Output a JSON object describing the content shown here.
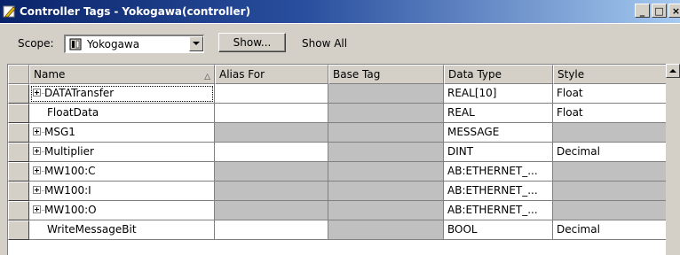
{
  "window": {
    "title": "Controller Tags",
    "title_sep": "-",
    "subtitle": "Yokogawa(controller)",
    "btn_minimize": "_",
    "btn_maximize": "□",
    "btn_close": "×"
  },
  "toolbar": {
    "scope_label": "Scope:",
    "scope_value": "Yokogawa",
    "show_button": "Show...",
    "show_filter": "Show All"
  },
  "grid": {
    "headers": {
      "name": "Name",
      "alias": "Alias For",
      "base": "Base Tag",
      "type": "Data Type",
      "style": "Style"
    },
    "rows": [
      {
        "name": "DATATransfer",
        "expandable": true,
        "alias": "",
        "base": "",
        "type": "REAL[10]",
        "style": "Float",
        "editable": true
      },
      {
        "name": "FloatData",
        "expandable": false,
        "alias": "",
        "base": "",
        "type": "REAL",
        "style": "Float",
        "editable": true
      },
      {
        "name": "MSG1",
        "expandable": true,
        "alias": "",
        "base": "",
        "type": "MESSAGE",
        "style": "",
        "editable": false
      },
      {
        "name": "Multiplier",
        "expandable": true,
        "alias": "",
        "base": "",
        "type": "DINT",
        "style": "Decimal",
        "editable": true
      },
      {
        "name": "MW100:C",
        "expandable": true,
        "alias": "",
        "base": "",
        "type": "AB:ETHERNET_...",
        "style": "",
        "editable": false
      },
      {
        "name": "MW100:I",
        "expandable": true,
        "alias": "",
        "base": "",
        "type": "AB:ETHERNET_...",
        "style": "",
        "editable": false
      },
      {
        "name": "MW100:O",
        "expandable": true,
        "alias": "",
        "base": "",
        "type": "AB:ETHERNET_...",
        "style": "",
        "editable": false
      },
      {
        "name": "WriteMessageBit",
        "expandable": false,
        "alias": "",
        "base": "",
        "type": "BOOL",
        "style": "Decimal",
        "editable": true
      }
    ]
  },
  "colors": {
    "titlebar_start": "#0a246a",
    "titlebar_end": "#a6caf0",
    "readonly_cell": "#c0c0c0",
    "editable_cell": "#ffffff"
  }
}
